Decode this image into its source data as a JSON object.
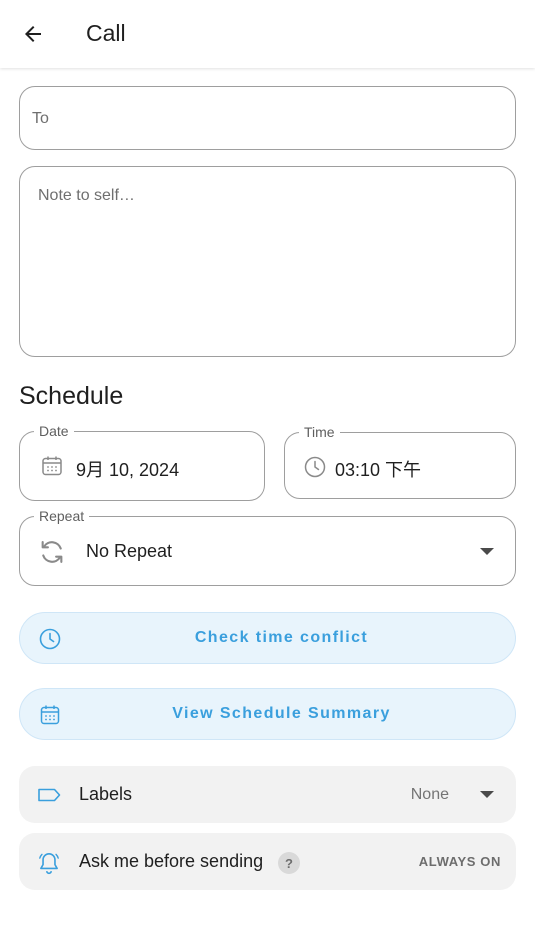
{
  "header": {
    "title": "Call",
    "back_icon": "arrow-left-icon"
  },
  "compose": {
    "to_placeholder": "To",
    "to_value": "",
    "note_placeholder": "Note to self…",
    "note_value": ""
  },
  "schedule": {
    "section_title": "Schedule",
    "date": {
      "label": "Date",
      "value": "9月 10, 2024",
      "icon": "calendar-icon"
    },
    "time": {
      "label": "Time",
      "value": "03:10 下午",
      "icon": "clock-icon"
    },
    "repeat": {
      "label": "Repeat",
      "value": "No Repeat",
      "icon": "repeat-icon"
    }
  },
  "actions": {
    "check_conflict": {
      "label": "Check time conflict",
      "icon": "clock-icon"
    },
    "view_summary": {
      "label": "View Schedule Summary",
      "icon": "calendar-icon"
    }
  },
  "options": {
    "labels": {
      "label": "Labels",
      "value": "None",
      "icon": "label-tag-icon"
    },
    "ask_before_sending": {
      "label": "Ask me before sending",
      "help": "?",
      "status": "ALWAYS ON",
      "icon": "bell-icon"
    }
  },
  "colors": {
    "accent": "#3a9fdd",
    "accent_bg": "#e8f4fc",
    "card_bg": "#f2f2f2",
    "outline": "#9e9e9e"
  }
}
